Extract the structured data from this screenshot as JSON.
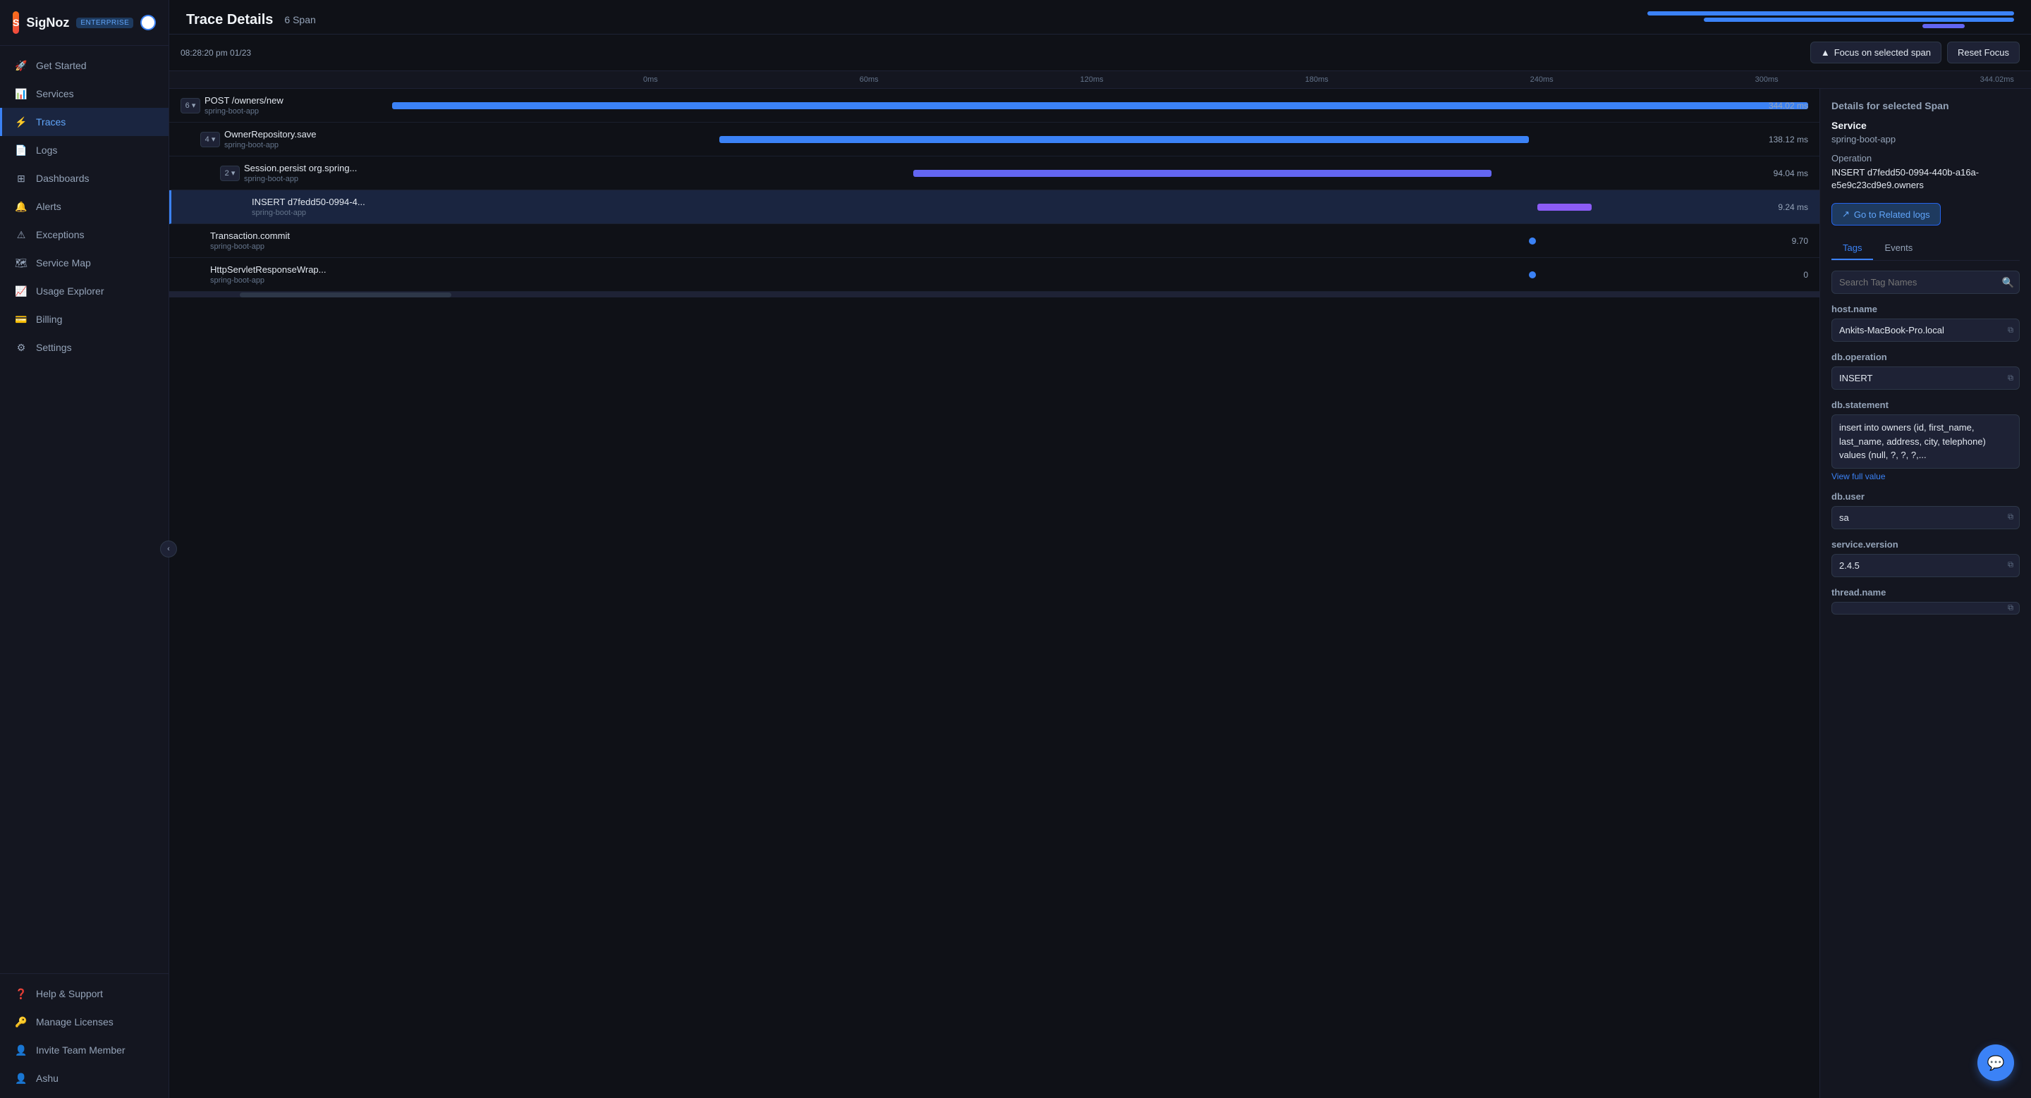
{
  "app": {
    "name": "SigNoz",
    "badge": "ENTERPRISE"
  },
  "sidebar": {
    "nav_items": [
      {
        "id": "get-started",
        "label": "Get Started",
        "icon": "rocket"
      },
      {
        "id": "services",
        "label": "Services",
        "icon": "bar-chart"
      },
      {
        "id": "traces",
        "label": "Traces",
        "icon": "activity",
        "active": true
      },
      {
        "id": "logs",
        "label": "Logs",
        "icon": "file-text"
      },
      {
        "id": "dashboards",
        "label": "Dashboards",
        "icon": "grid"
      },
      {
        "id": "alerts",
        "label": "Alerts",
        "icon": "bell"
      },
      {
        "id": "exceptions",
        "label": "Exceptions",
        "icon": "alert-triangle"
      },
      {
        "id": "service-map",
        "label": "Service Map",
        "icon": "map"
      },
      {
        "id": "usage-explorer",
        "label": "Usage Explorer",
        "icon": "trending-up"
      },
      {
        "id": "billing",
        "label": "Billing",
        "icon": "credit-card"
      },
      {
        "id": "settings",
        "label": "Settings",
        "icon": "settings"
      }
    ],
    "bottom_items": [
      {
        "id": "help-support",
        "label": "Help & Support",
        "icon": "help-circle"
      },
      {
        "id": "manage-licenses",
        "label": "Manage Licenses",
        "icon": "key"
      },
      {
        "id": "invite-team-member",
        "label": "Invite Team Member",
        "icon": "user-plus"
      },
      {
        "id": "ashu",
        "label": "Ashu",
        "icon": "user"
      }
    ]
  },
  "trace": {
    "title": "Trace Details",
    "span_count_label": "6 Span",
    "timestamp": "08:28:20 pm 01/23",
    "time_marks": [
      "0ms",
      "60ms",
      "120ms",
      "180ms",
      "240ms",
      "300ms",
      "344.02ms"
    ]
  },
  "toolbar": {
    "focus_label": "Focus on selected span",
    "reset_label": "Reset Focus"
  },
  "spans": [
    {
      "id": "span-1",
      "indent": 0,
      "badge": "6",
      "name": "POST /owners/new",
      "service": "spring-boot-app",
      "duration": "344.02 ms",
      "bar_left": "0%",
      "bar_width": "100%",
      "bar_color": "blue",
      "selected": false
    },
    {
      "id": "span-2",
      "indent": 1,
      "badge": "4",
      "name": "OwnerRepository.save",
      "service": "spring-boot-app",
      "duration": "138.12 ms",
      "bar_left": "22%",
      "bar_width": "58%",
      "bar_color": "blue",
      "selected": false
    },
    {
      "id": "span-3",
      "indent": 2,
      "badge": "2",
      "name": "Session.persist org.spring...",
      "service": "spring-boot-app",
      "duration": "94.04 ms",
      "bar_left": "35%",
      "bar_width": "42%",
      "bar_color": "indigo",
      "selected": false
    },
    {
      "id": "span-4",
      "indent": 3,
      "badge": "",
      "name": "INSERT d7fedd50-0994-4...",
      "service": "spring-boot-app",
      "duration": "9.24 ms",
      "bar_left": "80%",
      "bar_width": "4%",
      "bar_color": "purple",
      "selected": true
    },
    {
      "id": "span-5",
      "indent": 1,
      "badge": "",
      "name": "Transaction.commit",
      "service": "spring-boot-app",
      "duration": "9.70",
      "bar_left": "80%",
      "bar_width": "4%",
      "bar_color": "dot blue",
      "selected": false
    },
    {
      "id": "span-6",
      "indent": 1,
      "badge": "",
      "name": "HttpServletResponseWrap...",
      "service": "spring-boot-app",
      "duration": "0",
      "bar_left": "80%",
      "bar_width": "1%",
      "bar_color": "dot blue",
      "selected": false
    }
  ],
  "right_panel": {
    "title": "Details for selected Span",
    "service_label": "Service",
    "service_value": "spring-boot-app",
    "operation_label": "Operation",
    "operation_value": "INSERT d7fedd50-0994-440b-a16a-e5e9c23cd9e9.owners",
    "goto_btn_label": "Go to Related logs",
    "tabs": [
      "Tags",
      "Events"
    ],
    "active_tab": "Tags",
    "search_placeholder": "Search Tag Names",
    "tags": [
      {
        "key": "host.name",
        "value": "Ankits-MacBook-Pro.local",
        "multiline": false
      },
      {
        "key": "db.operation",
        "value": "INSERT",
        "multiline": false
      },
      {
        "key": "db.statement",
        "value": "insert into owners (id, first_name, last_name, address, city, telephone) values (null, ?, ?, ?,...",
        "multiline": true,
        "view_full": "View full value"
      },
      {
        "key": "db.user",
        "value": "sa",
        "multiline": false
      },
      {
        "key": "service.version",
        "value": "2.4.5",
        "multiline": false
      },
      {
        "key": "thread.name",
        "value": "",
        "multiline": false
      }
    ]
  }
}
